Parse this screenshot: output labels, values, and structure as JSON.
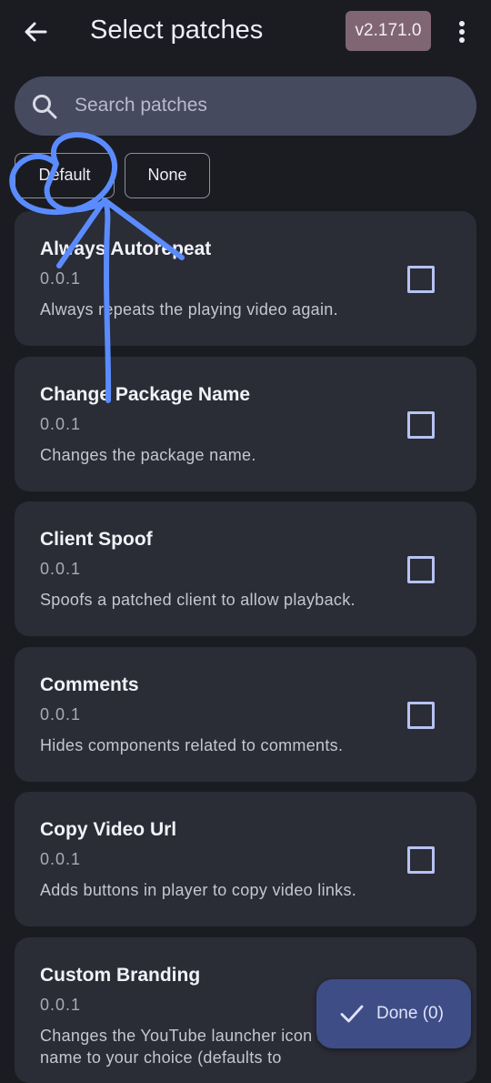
{
  "header": {
    "title": "Select patches",
    "version": "v2.171.0",
    "back_icon": "arrow-back-icon",
    "more_icon": "more-vert-icon"
  },
  "search": {
    "placeholder": "Search patches",
    "value": ""
  },
  "filters": {
    "default_label": "Default",
    "none_label": "None"
  },
  "patches": [
    {
      "name": "Always Autorepeat",
      "version": "0.0.1",
      "description": "Always repeats the playing video again.",
      "checked": false
    },
    {
      "name": "Change Package Name",
      "version": "0.0.1",
      "description": "Changes the package name.",
      "checked": false
    },
    {
      "name": "Client Spoof",
      "version": "0.0.1",
      "description": "Spoofs a patched client to allow playback.",
      "checked": false
    },
    {
      "name": "Comments",
      "version": "0.0.1",
      "description": "Hides components related to comments.",
      "checked": false
    },
    {
      "name": "Copy Video Url",
      "version": "0.0.1",
      "description": "Adds buttons in player to copy video links.",
      "checked": false
    },
    {
      "name": "Custom Branding",
      "version": "0.0.1",
      "description": "Changes the YouTube launcher icon and name to your choice (defaults to",
      "checked": false
    }
  ],
  "fab": {
    "label": "Done (0)",
    "icon": "check-icon"
  },
  "colors": {
    "background": "#1b1c22",
    "card": "#2a2c36",
    "search": "#454a5f",
    "version_chip": "#7f6672",
    "checkbox": "#b6c3f2",
    "fab": "#3f4d86",
    "annotation": "#5b8cff"
  }
}
